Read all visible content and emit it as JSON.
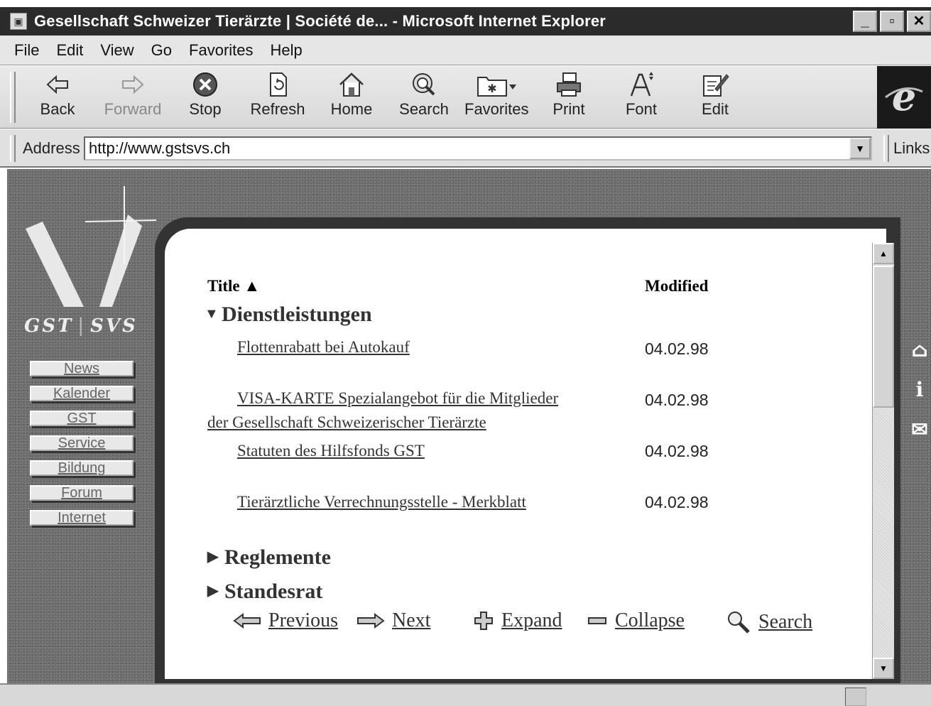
{
  "window": {
    "title": "Gesellschaft Schweizer Tierärzte | Société de... - Microsoft Internet Explorer",
    "minimize": "_",
    "maximize": "▫",
    "close": "✕"
  },
  "menu": [
    {
      "label": "File"
    },
    {
      "label": "Edit"
    },
    {
      "label": "View"
    },
    {
      "label": "Go"
    },
    {
      "label": "Favorites"
    },
    {
      "label": "Help"
    }
  ],
  "toolbar": {
    "back": "Back",
    "forward": "Forward",
    "stop": "Stop",
    "refresh": "Refresh",
    "home": "Home",
    "search": "Search",
    "favorites": "Favorites",
    "print": "Print",
    "font": "Font",
    "edit": "Edit"
  },
  "address": {
    "label": "Address",
    "url": "http://www.gstsvs.ch",
    "links": "Links"
  },
  "site": {
    "logo_left": "GST",
    "logo_right": "SVS",
    "nav": [
      "News",
      "Kalender",
      "GST",
      "Service",
      "Bildung",
      "Forum",
      "Internet"
    ]
  },
  "table": {
    "col_title": "Title ▲",
    "col_modified": "Modified",
    "categories": [
      {
        "name": "Dienstleistungen",
        "expanded": true,
        "rows": [
          {
            "title": "Flottenrabatt bei Autokauf",
            "modified": "04.02.98"
          },
          {
            "title_line1": "VISA-KARTE Spezialangebot für die Mitglieder",
            "title_line2": "der Gesellschaft Schweizerischer Tierärzte",
            "modified": "04.02.98"
          },
          {
            "title": "Statuten des Hilfsfonds GST",
            "modified": "04.02.98"
          },
          {
            "title": "Tierärztliche Verrechnungsstelle - Merkblatt",
            "modified": "04.02.98"
          }
        ]
      },
      {
        "name": "Reglemente",
        "expanded": false
      },
      {
        "name": "Standesrat",
        "expanded": false
      }
    ]
  },
  "pager": {
    "previous": "Previous",
    "next": "Next",
    "expand": "Expand",
    "collapse": "Collapse",
    "search": "Search"
  }
}
